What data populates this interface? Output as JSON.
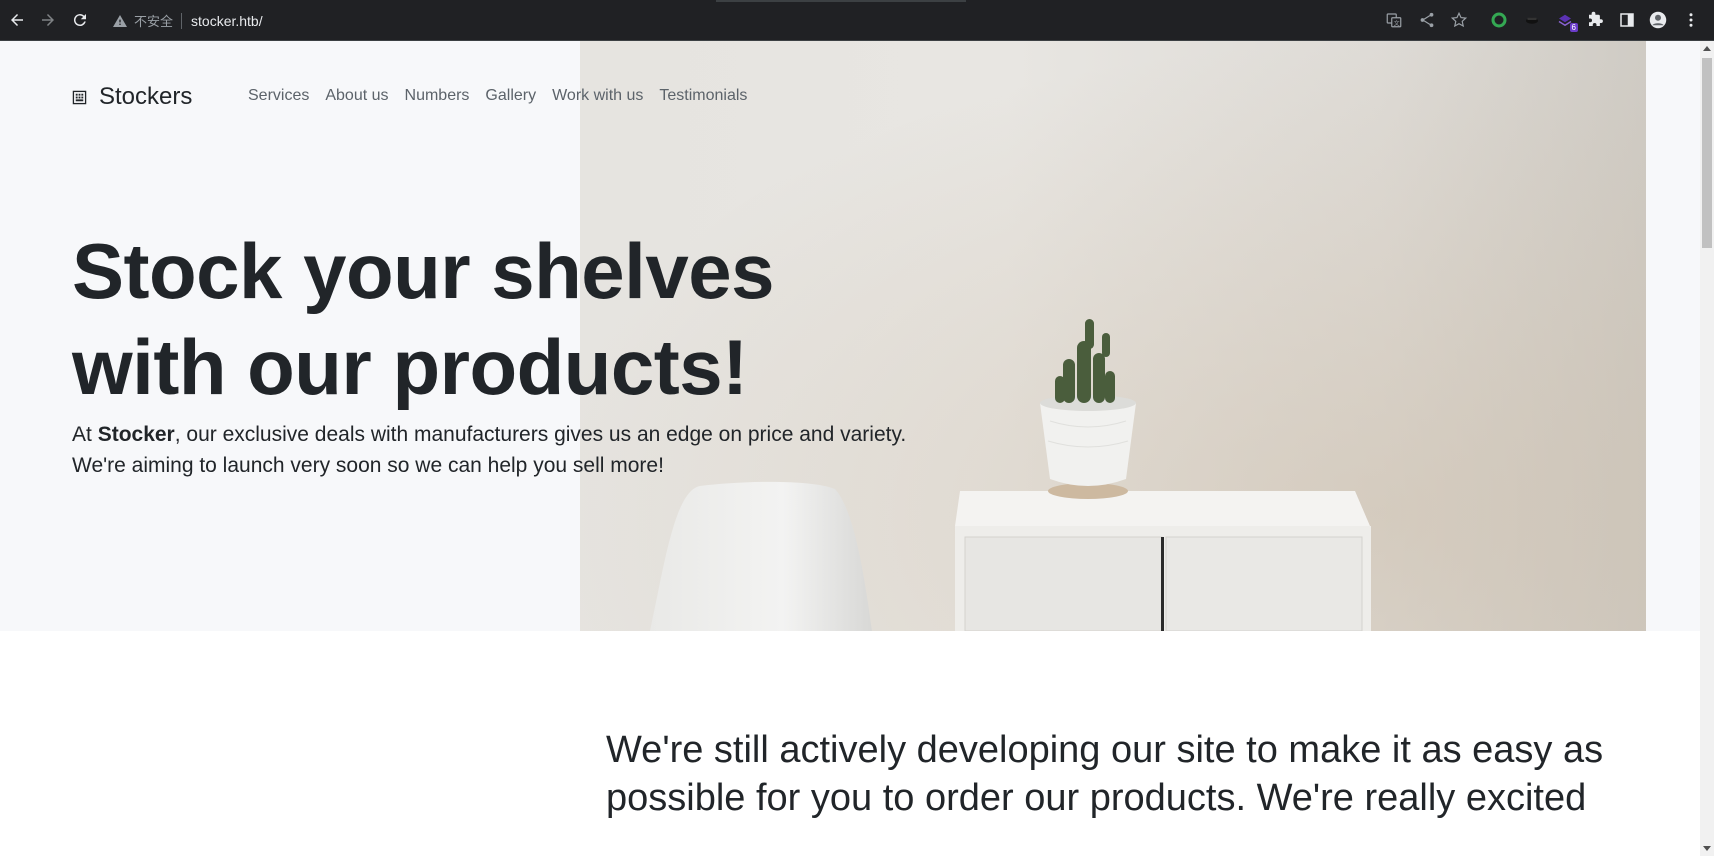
{
  "browser": {
    "security_label": "不安全",
    "url": "stocker.htb/",
    "extension_badge": "6",
    "icons": [
      "back-icon",
      "forward-icon",
      "reload-icon",
      "warning-icon",
      "translate-icon",
      "share-icon",
      "star-icon",
      "green-circle-extension-icon",
      "dark-extension-icon",
      "purple-extension-icon",
      "puzzle-icon",
      "side-panel-icon",
      "profile-icon",
      "menu-dots-icon"
    ]
  },
  "site": {
    "brand": "Stockers",
    "nav": [
      "Services",
      "About us",
      "Numbers",
      "Gallery",
      "Work with us",
      "Testimonials"
    ],
    "hero": {
      "headline_line1": "Stock your shelves",
      "headline_line2": "with our products!",
      "lead_prefix": "At ",
      "lead_brand": "Stocker",
      "lead_rest": ", our exclusive deals with manufacturers gives us an edge on price and variety. We're aiming to launch very soon so we can help you sell more!"
    },
    "development_note": "We're still actively developing our site to make it as easy as possible for you to order our products. We're really excited"
  }
}
